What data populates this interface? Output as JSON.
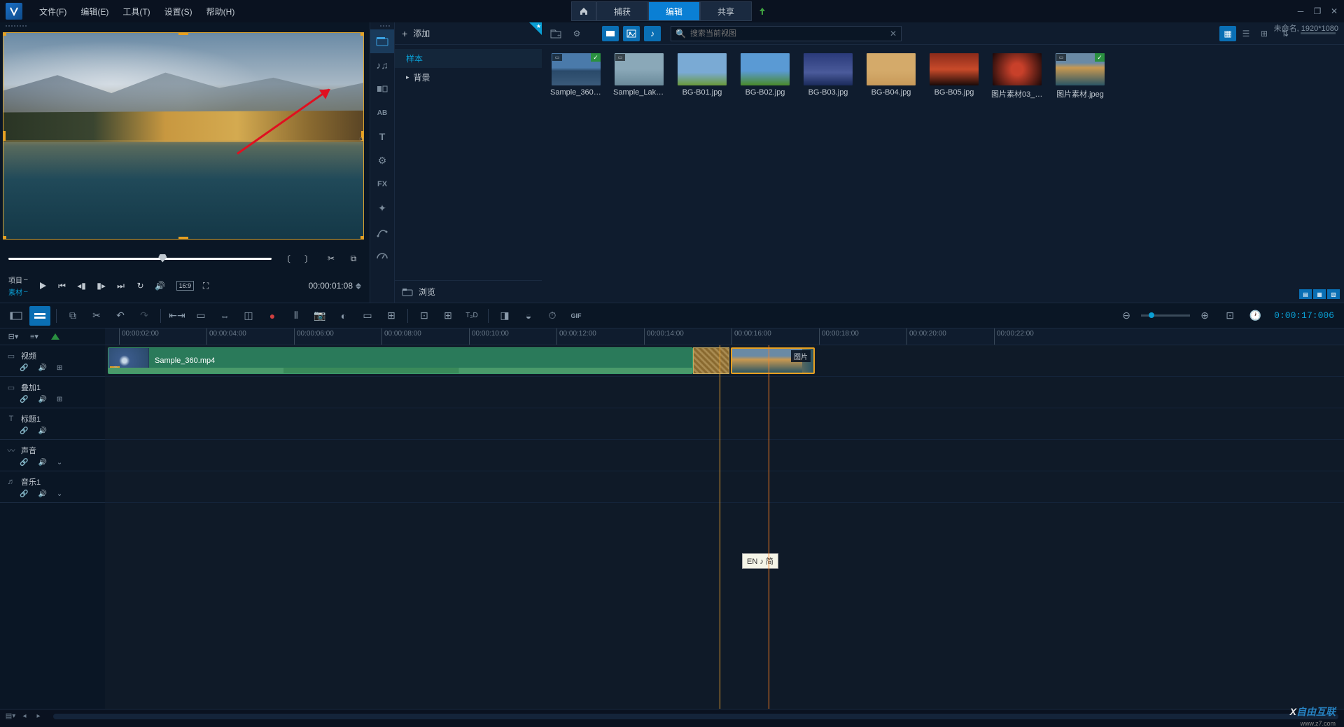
{
  "menubar": {
    "items": [
      "文件(F)",
      "编辑(E)",
      "工具(T)",
      "设置(S)",
      "帮助(H)"
    ]
  },
  "top_tabs": {
    "capture": "捕获",
    "edit": "编辑",
    "share": "共享"
  },
  "top_right": {
    "resolution": "未命名, 1920*1080"
  },
  "preview": {
    "project_label": "项目",
    "clip_label": "素材",
    "aspect": "16:9",
    "timecode": "00:00:01:08"
  },
  "library": {
    "add_label": "添加",
    "tree": {
      "sample": "样本",
      "background": "背景"
    },
    "browse_label": "浏览",
    "search_placeholder": "搜索当前视图",
    "thumbs": [
      {
        "name": "Sample_360.m...",
        "check": true,
        "badge": true,
        "bg": "linear-gradient(to bottom,#4a7aaa 45%,#2a4a6a 55%,#3a5a7a)"
      },
      {
        "name": "Sample_Lake....",
        "check": false,
        "badge": true,
        "bg": "linear-gradient(to bottom,#8aa8b8 50%,#6a8a9a)"
      },
      {
        "name": "BG-B01.jpg",
        "check": false,
        "badge": false,
        "bg": "linear-gradient(to bottom,#7aaad4 60%,#6a9a3a)"
      },
      {
        "name": "BG-B02.jpg",
        "check": false,
        "badge": false,
        "bg": "linear-gradient(to bottom,#5a9ad4 55%,#4a8a2a)"
      },
      {
        "name": "BG-B03.jpg",
        "check": false,
        "badge": false,
        "bg": "linear-gradient(to bottom,#2a3a7a,#4a5a9a 60%,#1a2a5a)"
      },
      {
        "name": "BG-B04.jpg",
        "check": false,
        "badge": false,
        "bg": "linear-gradient(to bottom,#d4aa6a 55%,#c89a5a)"
      },
      {
        "name": "BG-B05.jpg",
        "check": false,
        "badge": false,
        "bg": "linear-gradient(to bottom,#8a2a1a,#c84a2a 50%,#1a0a08)"
      },
      {
        "name": "图片素材03_副...",
        "check": false,
        "badge": false,
        "bg": "radial-gradient(circle,#c8402a 20%,#1a0808)"
      },
      {
        "name": "图片素材.jpeg",
        "check": true,
        "badge": true,
        "bg": "linear-gradient(to bottom,#6a8aa5 30%,#c89850 45%,#2a5565)"
      }
    ]
  },
  "timeline": {
    "timecode": "0:00:17:006",
    "ruler": [
      "00:00:02:00",
      "00:00:04:00",
      "00:00:06:00",
      "00:00:08:00",
      "00:00:10:00",
      "00:00:12:00",
      "00:00:14:00",
      "00:00:16:00",
      "00:00:18:00",
      "00:00:20:00",
      "00:00:22:00"
    ],
    "tracks": {
      "video": "视频",
      "overlay": "叠加1",
      "title": "标题1",
      "sound": "声音",
      "music": "音乐1"
    },
    "clip1_label": "Sample_360.mp4",
    "clip2_label": "图片"
  },
  "ime": "EN ♪ 简",
  "watermark": "自由互联",
  "watermark_url": "www.z7.com"
}
